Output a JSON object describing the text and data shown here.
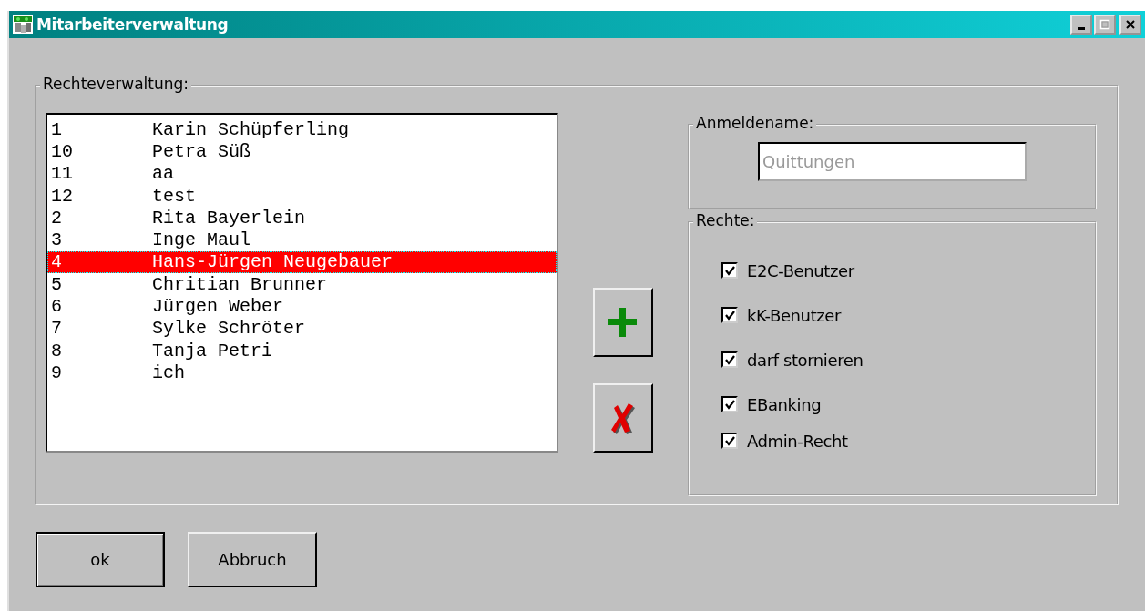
{
  "window": {
    "title": "Mitarbeiterverwaltung"
  },
  "rights_group": {
    "label": "Rechteverwaltung:"
  },
  "employees": [
    {
      "id": "1",
      "name": "Karin Schüpferling",
      "selected": false
    },
    {
      "id": "10",
      "name": "Petra Süß",
      "selected": false
    },
    {
      "id": "11",
      "name": "aa",
      "selected": false
    },
    {
      "id": "12",
      "name": "test",
      "selected": false
    },
    {
      "id": "2",
      "name": "Rita Bayerlein",
      "selected": false
    },
    {
      "id": "3",
      "name": "Inge Maul",
      "selected": false
    },
    {
      "id": "4",
      "name": "Hans-Jürgen Neugebauer",
      "selected": true
    },
    {
      "id": "5",
      "name": "Chritian Brunner",
      "selected": false
    },
    {
      "id": "6",
      "name": "Jürgen Weber",
      "selected": false
    },
    {
      "id": "7",
      "name": "Sylke Schröter",
      "selected": false
    },
    {
      "id": "8",
      "name": "Tanja Petri",
      "selected": false
    },
    {
      "id": "9",
      "name": "ich",
      "selected": false
    }
  ],
  "login": {
    "label": "Anmeldename:",
    "value": "Quittungen",
    "disabled": true
  },
  "permissions": {
    "label": "Rechte:",
    "items": [
      {
        "label": "E2C-Benutzer",
        "checked": true
      },
      {
        "label": "kK-Benutzer",
        "checked": true
      },
      {
        "label": "darf stornieren",
        "checked": true
      },
      {
        "label": "EBanking",
        "checked": true
      },
      {
        "label": "Admin-Recht",
        "checked": true
      }
    ]
  },
  "buttons": [
    {
      "label": "ok"
    },
    {
      "label": "Abbruch"
    }
  ]
}
